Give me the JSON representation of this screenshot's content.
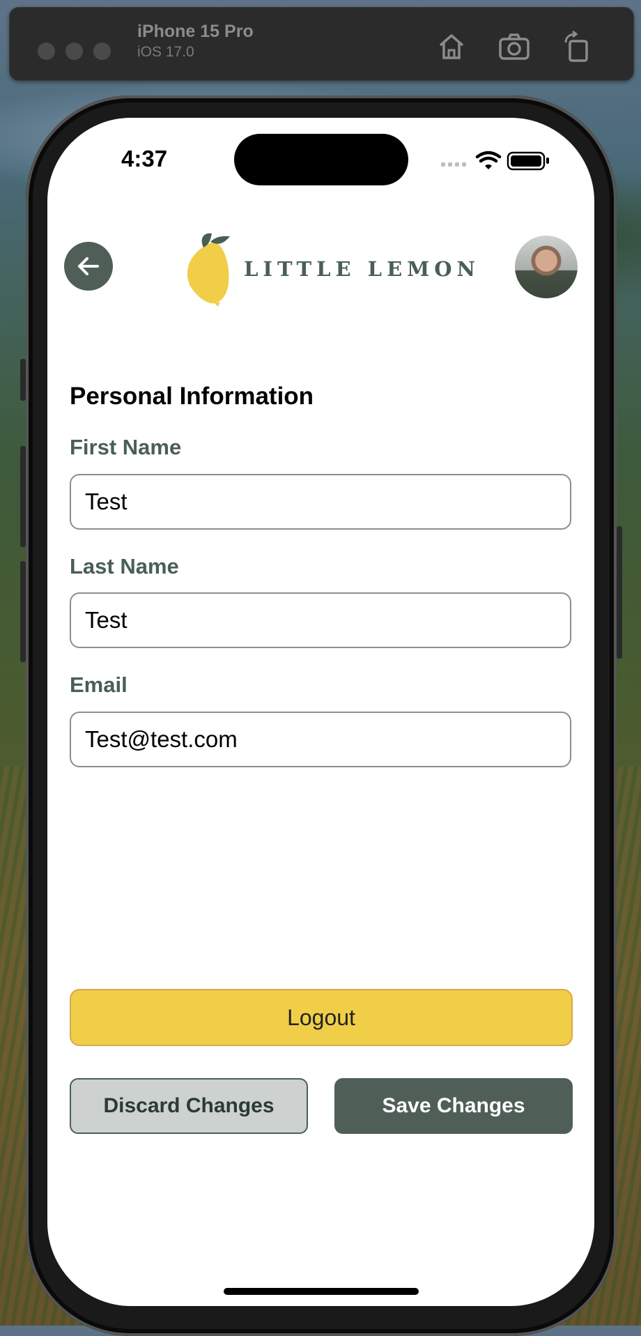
{
  "simulator": {
    "device_name": "iPhone 15 Pro",
    "os_version": "iOS 17.0",
    "icons": [
      "home-icon",
      "screenshot-icon",
      "rotate-icon"
    ]
  },
  "status_bar": {
    "time": "4:37",
    "icons": [
      "cellular-signal-icon",
      "wifi-icon",
      "battery-icon"
    ]
  },
  "header": {
    "brand_name": "LITTLE LEMON",
    "back_icon": "back-arrow-icon",
    "avatar": "profile-avatar"
  },
  "form": {
    "section_title": "Personal Information",
    "first_name": {
      "label": "First Name",
      "value": "Test"
    },
    "last_name": {
      "label": "Last Name",
      "value": "Test"
    },
    "email": {
      "label": "Email",
      "value": "Test@test.com"
    }
  },
  "actions": {
    "logout_label": "Logout",
    "discard_label": "Discard Changes",
    "save_label": "Save Changes"
  },
  "colors": {
    "primary_green": "#495e57",
    "lemon_yellow": "#f4ce14",
    "button_gray": "#cdd1d0"
  }
}
